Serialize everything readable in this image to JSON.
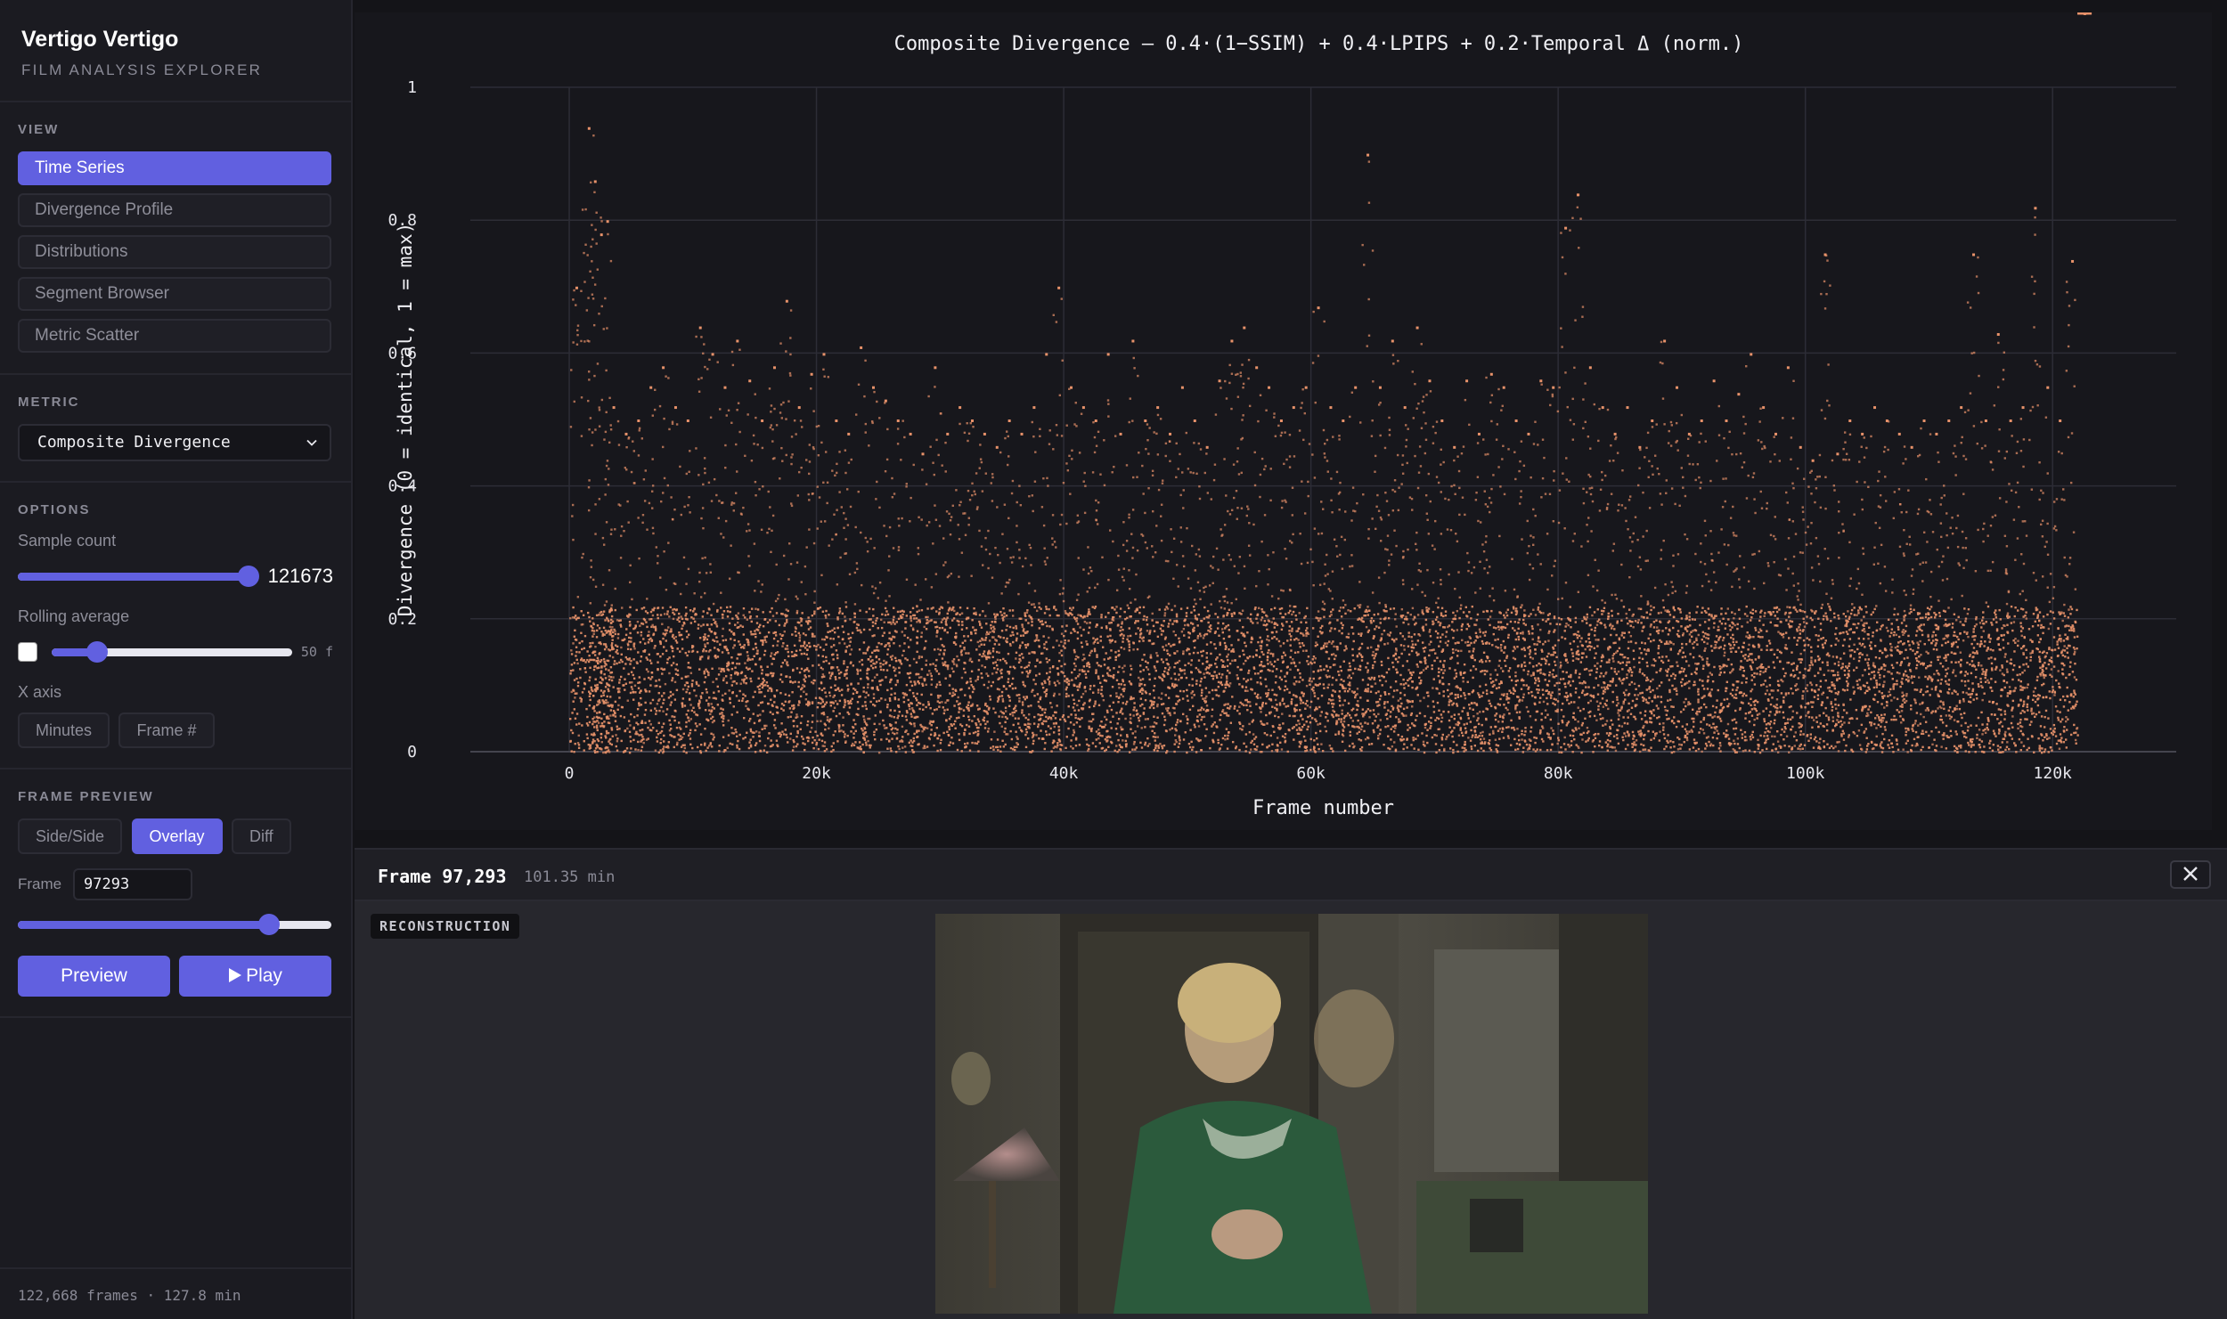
{
  "app": {
    "title": "Vertigo Vertigo",
    "subtitle": "FILM ANALYSIS EXPLORER"
  },
  "view": {
    "label": "VIEW",
    "items": [
      {
        "label": "Time Series",
        "active": true
      },
      {
        "label": "Divergence Profile",
        "active": false
      },
      {
        "label": "Distributions",
        "active": false
      },
      {
        "label": "Segment Browser",
        "active": false
      },
      {
        "label": "Metric Scatter",
        "active": false
      }
    ]
  },
  "metric": {
    "label": "METRIC",
    "selected": "Composite Divergence"
  },
  "options": {
    "label": "OPTIONS",
    "sample_count_label": "Sample count",
    "sample_count_value": "121673",
    "sample_count_fraction": 0.96,
    "rolling_label": "Rolling average",
    "rolling_value": "50 f",
    "rolling_fraction": 0.19,
    "rolling_enabled": false,
    "x_axis_label": "X axis",
    "x_axis_options": [
      "Minutes",
      "Frame #"
    ]
  },
  "frame_preview": {
    "label": "FRAME PREVIEW",
    "modes": [
      {
        "label": "Side/Side",
        "active": false
      },
      {
        "label": "Overlay",
        "active": true
      },
      {
        "label": "Diff",
        "active": false
      }
    ],
    "frame_label": "Frame",
    "frame_value": "97293",
    "frame_fraction": 0.8,
    "preview_button": "Preview",
    "play_button": "Play"
  },
  "footer": {
    "text": "122,668 frames · 127.8 min"
  },
  "preview": {
    "title": "Frame 97,293",
    "minutes": "101.35 min",
    "tag": "RECONSTRUCTION"
  },
  "colors": {
    "accent": "#6160e0",
    "series": "#e8926a",
    "background": "#141418"
  },
  "chart_data": {
    "type": "scatter",
    "title": "Composite Divergence — 0.4·(1−SSIM) + 0.4·LPIPS + 0.2·Temporal Δ (norm.)",
    "xlabel": "Frame number",
    "ylabel": "Divergence (0 = identical, 1 = max)",
    "xlim": [
      -8000,
      130000
    ],
    "ylim": [
      0,
      1
    ],
    "x_ticks": [
      0,
      20000,
      40000,
      60000,
      80000,
      100000,
      120000
    ],
    "x_tick_labels": [
      "0",
      "20k",
      "40k",
      "60k",
      "80k",
      "100k",
      "120k"
    ],
    "y_ticks": [
      0,
      0.2,
      0.4,
      0.6,
      0.8,
      1
    ],
    "y_tick_labels": [
      "0",
      "0.2",
      "0.4",
      "0.6",
      "0.8",
      "1"
    ],
    "grid": true,
    "series": [
      {
        "color": "#e8926a",
        "x": [
          0,
          1000,
          1500,
          2000,
          2500,
          3000,
          4000,
          5000,
          6000,
          7000,
          8000,
          9000,
          10000,
          11000,
          12000,
          13000,
          14000,
          15000,
          16000,
          17000,
          18000,
          19000,
          20000,
          21000,
          22000,
          23000,
          24000,
          25000,
          26000,
          27000,
          28000,
          29000,
          30000,
          31000,
          32000,
          33000,
          34000,
          35000,
          36000,
          37000,
          38000,
          39000,
          40000,
          41000,
          42000,
          43000,
          44000,
          45000,
          46000,
          47000,
          48000,
          49000,
          50000,
          51000,
          52000,
          53000,
          54000,
          55000,
          56000,
          57000,
          58000,
          59000,
          60000,
          61000,
          62000,
          63000,
          64000,
          65000,
          66000,
          67000,
          68000,
          69000,
          70000,
          71000,
          72000,
          73000,
          74000,
          75000,
          76000,
          77000,
          78000,
          79000,
          80000,
          81000,
          82000,
          83000,
          84000,
          85000,
          86000,
          87000,
          88000,
          89000,
          90000,
          91000,
          92000,
          93000,
          94000,
          95000,
          96000,
          97000,
          98000,
          99000,
          100000,
          101000,
          102000,
          103000,
          104000,
          105000,
          106000,
          107000,
          108000,
          109000,
          110000,
          111000,
          112000,
          113000,
          114000,
          115000,
          116000,
          117000,
          118000,
          119000,
          120000,
          121000,
          122000
        ],
        "peak": [
          0.7,
          0.94,
          0.86,
          0.78,
          0.8,
          0.52,
          0.48,
          0.5,
          0.55,
          0.58,
          0.52,
          0.5,
          0.64,
          0.6,
          0.55,
          0.62,
          0.56,
          0.5,
          0.58,
          0.68,
          0.52,
          0.57,
          0.6,
          0.5,
          0.48,
          0.61,
          0.55,
          0.53,
          0.5,
          0.48,
          0.45,
          0.58,
          0.48,
          0.52,
          0.5,
          0.48,
          0.46,
          0.5,
          0.48,
          0.52,
          0.6,
          0.7,
          0.55,
          0.52,
          0.5,
          0.6,
          0.48,
          0.62,
          0.5,
          0.52,
          0.48,
          0.55,
          0.5,
          0.46,
          0.56,
          0.62,
          0.64,
          0.58,
          0.55,
          0.5,
          0.52,
          0.55,
          0.67,
          0.52,
          0.5,
          0.55,
          0.9,
          0.55,
          0.62,
          0.52,
          0.64,
          0.56,
          0.5,
          0.46,
          0.56,
          0.48,
          0.57,
          0.55,
          0.5,
          0.48,
          0.56,
          0.55,
          0.79,
          0.84,
          0.58,
          0.52,
          0.48,
          0.52,
          0.46,
          0.5,
          0.62,
          0.55,
          0.48,
          0.5,
          0.56,
          0.5,
          0.54,
          0.6,
          0.52,
          0.48,
          0.58,
          0.46,
          0.44,
          0.75,
          0.45,
          0.5,
          0.48,
          0.52,
          0.5,
          0.48,
          0.46,
          0.5,
          0.48,
          0.5,
          0.52,
          0.75,
          0.5,
          0.63,
          0.5,
          0.52,
          0.82,
          0.55,
          0.5,
          0.74
        ]
      }
    ]
  }
}
